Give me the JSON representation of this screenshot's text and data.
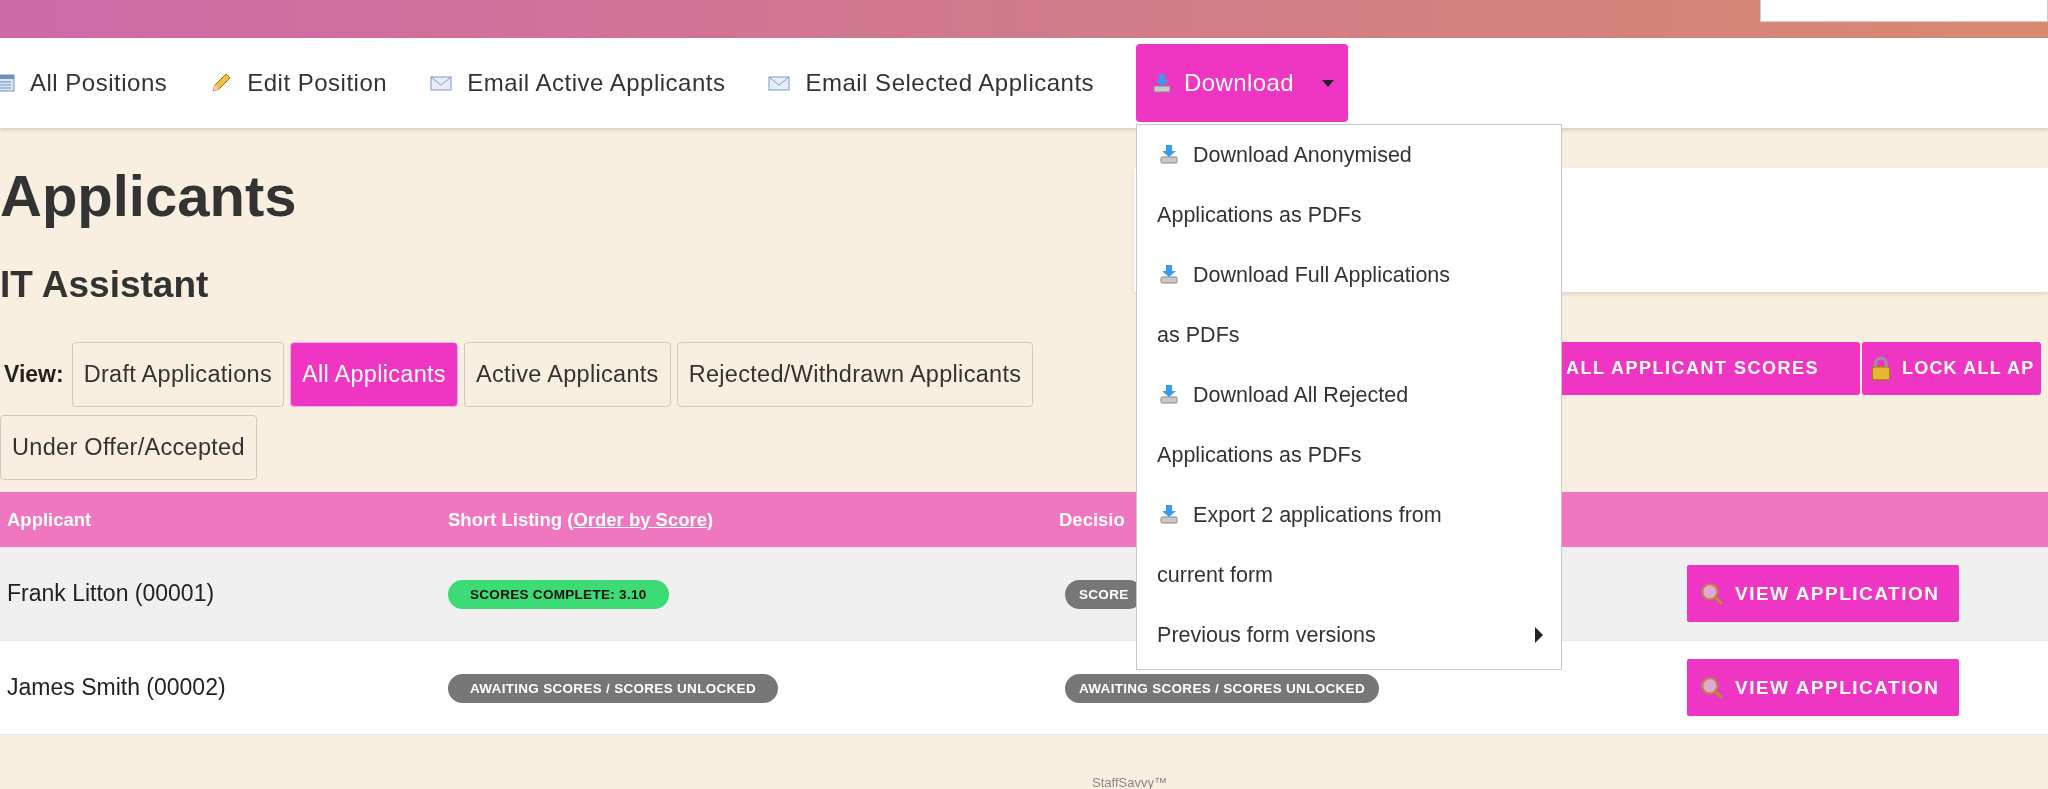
{
  "toolbar": [
    {
      "kind": "link",
      "label": "All Positions"
    },
    {
      "kind": "link",
      "label": "Edit Position"
    },
    {
      "kind": "link",
      "label": "Email Active Applicants"
    },
    {
      "kind": "link",
      "label": "Email Selected Applicants"
    },
    {
      "kind": "dropdown",
      "label": "Download",
      "expanded": true
    }
  ],
  "download_menu": [
    {
      "kind": "download",
      "label": "Download Anonymised Applications as PDFs"
    },
    {
      "kind": "download",
      "label": "Download Full Applications as PDFs"
    },
    {
      "kind": "download",
      "label": "Download All Rejected Applications as PDFs"
    },
    {
      "kind": "download",
      "label": "Export 2 applications from current form"
    },
    {
      "kind": "submenu",
      "label": "Previous form versions"
    }
  ],
  "page_title": "Applicants",
  "position_title": "IT Assistant",
  "view_label": "View:",
  "view_tabs": [
    {
      "label": "Draft Applications",
      "selected": false
    },
    {
      "label": "All Applicants",
      "selected": true
    },
    {
      "label": "Active Applicants",
      "selected": false
    },
    {
      "label": "Rejected/Withdrawn Applicants",
      "selected": false
    },
    {
      "label": "Under Offer/Accepted",
      "selected": false
    }
  ],
  "actions": [
    {
      "label": "ALL APPLICANT SCORES"
    },
    {
      "label": "LOCK ALL AP"
    }
  ],
  "table": {
    "columns": [
      {
        "label": "Applicant"
      },
      {
        "label": "Short Listing (",
        "link": "Order by Score",
        "after": ")"
      },
      {
        "label": "Decisio"
      }
    ],
    "rows": [
      {
        "applicant": "Frank Litton (00001)",
        "short_listing": {
          "text": "SCORES COMPLETE: 3.10",
          "kind": "complete"
        },
        "decision": {
          "text": "SCORE",
          "kind": "awaiting"
        },
        "button": "VIEW APPLICATION"
      },
      {
        "applicant": "James Smith (00002)",
        "short_listing": {
          "text": "AWAITING SCORES / SCORES UNLOCKED",
          "kind": "awaiting"
        },
        "decision": {
          "text": "AWAITING SCORES / SCORES UNLOCKED",
          "kind": "awaiting"
        },
        "button": "VIEW APPLICATION"
      }
    ]
  },
  "footer": "StaffSavvy™"
}
